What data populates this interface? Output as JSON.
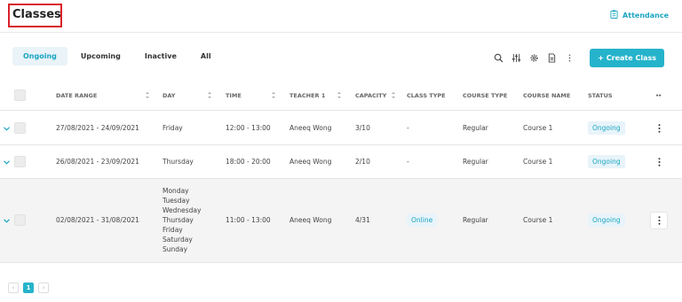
{
  "header": {
    "title": "Classes",
    "attendance_label": "Attendance"
  },
  "tabs": [
    {
      "label": "Ongoing",
      "active": true
    },
    {
      "label": "Upcoming",
      "active": false
    },
    {
      "label": "Inactive",
      "active": false
    },
    {
      "label": "All",
      "active": false
    }
  ],
  "toolbar": {
    "icons": [
      "search-icon",
      "filter-sliders-icon",
      "gear-icon",
      "export-file-icon",
      "more-vertical-icon"
    ],
    "create_label": "+ Create Class"
  },
  "table": {
    "columns": [
      "DATE RANGE",
      "DAY",
      "TIME",
      "TEACHER 1",
      "CAPACITY",
      "CLASS TYPE",
      "COURSE TYPE",
      "COURSE NAME",
      "STATUS",
      "••"
    ],
    "rows": [
      {
        "date_range": "27/08/2021 - 24/09/2021",
        "day": [
          "Friday"
        ],
        "time": "12:00 - 13:00",
        "teacher": "Aneeq Wong",
        "capacity": "3/10",
        "class_type": "-",
        "course_type": "Regular",
        "course_name": "Course 1",
        "status": "Ongoing"
      },
      {
        "date_range": "26/08/2021 - 23/09/2021",
        "day": [
          "Thursday"
        ],
        "time": "18:00 - 20:00",
        "teacher": "Aneeq Wong",
        "capacity": "2/10",
        "class_type": "-",
        "course_type": "Regular",
        "course_name": "Course 1",
        "status": "Ongoing"
      },
      {
        "date_range": "02/08/2021 - 31/08/2021",
        "day": [
          "Monday",
          "Tuesday",
          "Wednesday",
          "Thursday",
          "Friday",
          "Saturday",
          "Sunday"
        ],
        "time": "11:00 - 13:00",
        "teacher": "Aneeq Wong",
        "capacity": "4/31",
        "class_type": "Online",
        "course_type": "Regular",
        "course_name": "Course 1",
        "status": "Ongoing"
      }
    ]
  },
  "pagination": {
    "prev_symbol": "‹",
    "current_page": "1",
    "next_symbol": "›"
  },
  "colors": {
    "accent": "#25b3cb",
    "highlight_border": "#d9232a"
  }
}
